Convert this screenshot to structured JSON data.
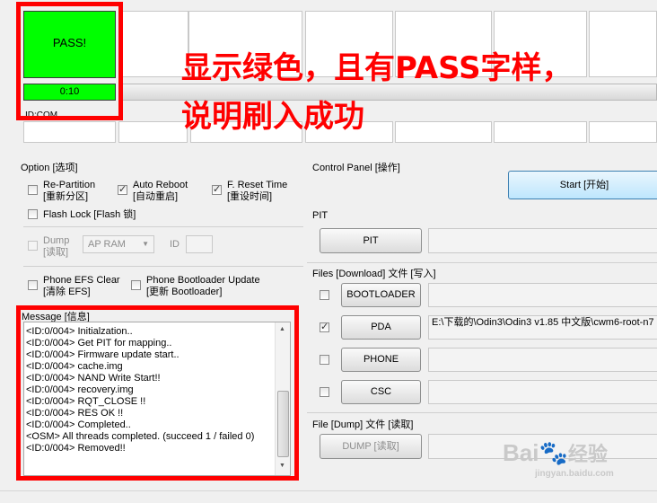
{
  "status_area": {
    "pass_text": "PASS!",
    "timer": "0:10",
    "com_label": "ID:COM"
  },
  "annotation": {
    "line1": "显示绿色，且有PASS字样，",
    "line2": "说明刷入成功"
  },
  "options": {
    "title": "Option [选项]",
    "repartition": {
      "line1": "Re-Partition",
      "line2": "[重新分区]",
      "checked": false
    },
    "auto_reboot": {
      "line1": "Auto Reboot",
      "line2": "[自动重启]",
      "checked": true
    },
    "f_reset_time": {
      "line1": "F. Reset Time",
      "line2": "[重设时间]",
      "checked": true
    },
    "flash_lock": {
      "label": "Flash Lock [Flash 锁]",
      "checked": false
    },
    "dump": {
      "line1": "Dump",
      "line2": "[读取]",
      "checked": false
    },
    "ap_ram": "AP RAM",
    "id_label": "ID",
    "phone_efs": {
      "line1": "Phone EFS Clear",
      "line2": "[清除 EFS]",
      "checked": false
    },
    "phone_bootloader": {
      "line1": "Phone Bootloader Update",
      "line2": "[更新 Bootloader]",
      "checked": false
    }
  },
  "message": {
    "title": "Message [信息]",
    "lines": [
      "<ID:0/004> Initialzation..",
      "<ID:0/004> Get PIT for mapping..",
      "<ID:0/004> Firmware update start..",
      "<ID:0/004> cache.img",
      "<ID:0/004> NAND Write Start!!",
      "<ID:0/004> recovery.img",
      "<ID:0/004> RQT_CLOSE !!",
      "<ID:0/004> RES OK !!",
      "<ID:0/004> Completed..",
      "<OSM> All threads completed. (succeed 1 / failed 0)",
      "<ID:0/004> Removed!!"
    ]
  },
  "control_panel": {
    "title": "Control Panel [操作]",
    "start_label": "Start [开始]"
  },
  "pit": {
    "title": "PIT",
    "button": "PIT"
  },
  "files": {
    "title": "Files [Download] 文件 [写入]",
    "bootloader": {
      "label": "BOOTLOADER",
      "checked": false,
      "path": ""
    },
    "pda": {
      "label": "PDA",
      "checked": true,
      "path": "E:\\下载的\\Odin3\\Odin3 v1.85 中文版\\cwm6-root-n7"
    },
    "phone": {
      "label": "PHONE",
      "checked": false,
      "path": ""
    },
    "csc": {
      "label": "CSC",
      "checked": false,
      "path": ""
    }
  },
  "file_dump": {
    "title": "File [Dump] 文件 [读取]",
    "button": "DUMP [读取]"
  },
  "watermark": {
    "brand": "Bai",
    "suffix": "经验",
    "url": "jingyan.baidu.com"
  },
  "colors": {
    "pass_green": "#00ff00",
    "annotation_red": "#ff0000"
  }
}
